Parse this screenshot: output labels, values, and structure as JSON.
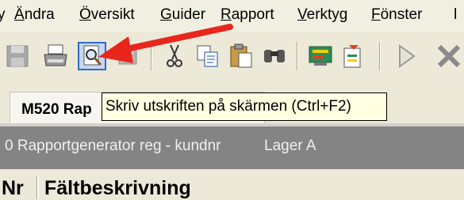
{
  "menu": {
    "items": [
      {
        "label": "Ändra"
      },
      {
        "label": "Översikt"
      },
      {
        "label": "Guider"
      },
      {
        "label": "Rapport"
      },
      {
        "label": "Verktyg"
      },
      {
        "label": "Fönster"
      }
    ],
    "partial_left": "y",
    "partial_right": "l"
  },
  "toolbar": {
    "buttons": [
      {
        "icon": "save-icon",
        "enabled": false
      },
      {
        "icon": "print-icon",
        "enabled": true
      },
      {
        "icon": "print-preview-icon",
        "enabled": true,
        "active": true
      },
      {
        "icon": "print-setup-icon",
        "enabled": false
      },
      {
        "icon": "cut-icon",
        "enabled": true
      },
      {
        "icon": "copy-icon",
        "enabled": true
      },
      {
        "icon": "paste-icon",
        "enabled": true
      },
      {
        "icon": "find-icon",
        "enabled": true
      },
      {
        "icon": "report-icon",
        "enabled": true
      },
      {
        "icon": "export-icon",
        "enabled": true
      },
      {
        "icon": "play-icon",
        "enabled": false
      },
      {
        "icon": "close-icon",
        "enabled": false
      }
    ]
  },
  "document": {
    "tab_title": "M520 Rap",
    "tooltip": "Skriv utskriften på skärmen (Ctrl+F2)"
  },
  "infobar": {
    "description": "0 Rapportgenerator reg - kundnr",
    "location": "Lager A"
  },
  "table": {
    "col_nr": "Nr",
    "col_desc": "Fältbeskrivning"
  },
  "colors": {
    "arrow": "#e8261c",
    "highlight": "#316ac5",
    "infobar_bg": "#848484",
    "tooltip_bg": "#ffffe1"
  }
}
